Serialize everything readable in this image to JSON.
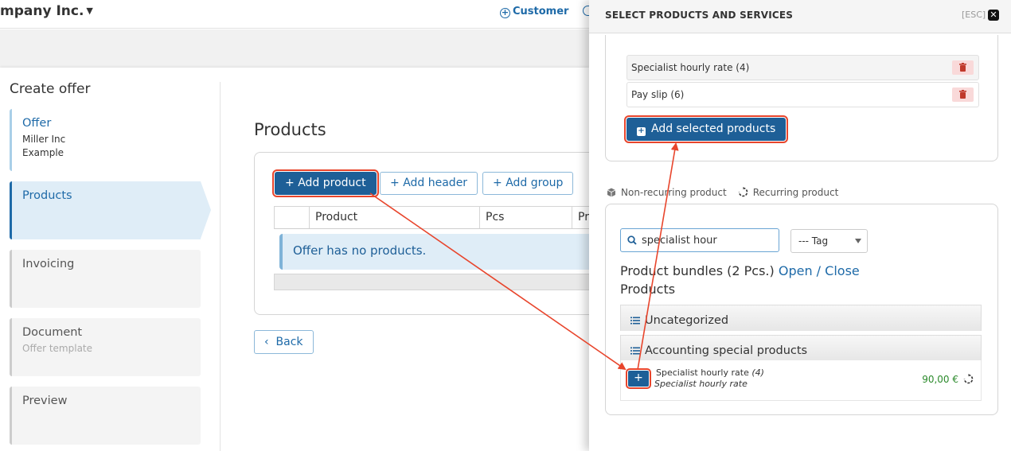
{
  "topbar": {
    "company": "mpany Inc.",
    "customer_link": "Customer"
  },
  "wizard": {
    "title": "Create offer",
    "steps": [
      {
        "title": "Offer",
        "sub1": "Miller Inc",
        "sub2": "Example"
      },
      {
        "title": "Products"
      },
      {
        "title": "Invoicing"
      },
      {
        "title": "Document",
        "sub1": "Offer template"
      },
      {
        "title": "Preview"
      }
    ]
  },
  "products": {
    "heading": "Products",
    "add_product": "Add product",
    "add_header": "Add header",
    "add_group": "Add group",
    "columns": [
      "Product",
      "Pcs",
      "Pri"
    ],
    "empty_message": "Offer has no products.",
    "back": "Back"
  },
  "panel": {
    "title": "SELECT PRODUCTS AND SERVICES",
    "esc": "[ESC]",
    "selected": [
      {
        "label": "Specialist hourly rate (4)"
      },
      {
        "label": "Pay slip (6)"
      }
    ],
    "add_selected": "Add selected products",
    "legend_nonrecurring": "Non-recurring product",
    "legend_recurring": "Recurring product",
    "search_value": "specialist hour",
    "tag_placeholder": "--- Tag",
    "bundles_label": "Product bundles (2 Pcs.)",
    "open_close": "Open / Close",
    "products_label": "Products",
    "categories": [
      "Uncategorized",
      "Accounting special products"
    ],
    "item": {
      "name": "Specialist hourly rate",
      "count": "(4)",
      "description": "Specialist hourly rate",
      "price": "90,00 €"
    }
  },
  "colors": {
    "primary": "#1e5f97",
    "link": "#1e6aa8",
    "highlight": "#e8452c",
    "price": "#2b8a2b"
  }
}
